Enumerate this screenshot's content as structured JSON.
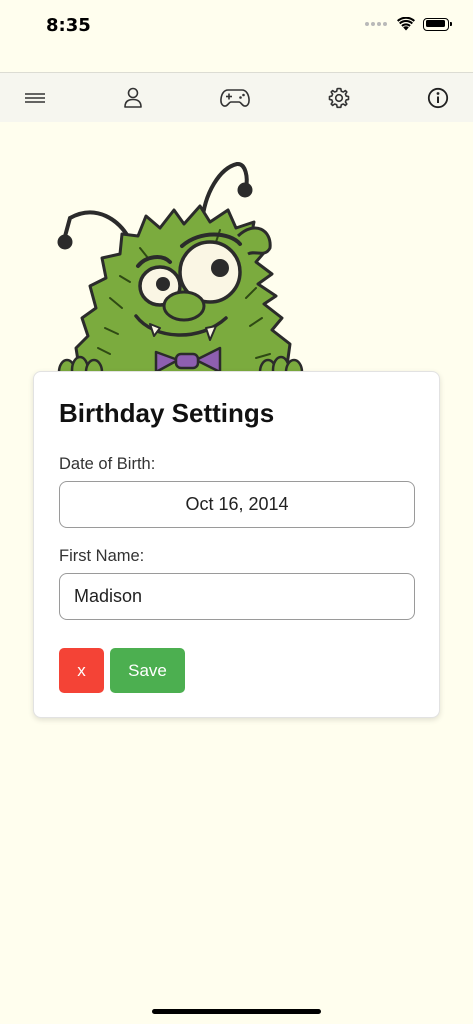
{
  "status_bar": {
    "time": "8:35"
  },
  "toolbar": {
    "items": [
      {
        "name": "menu",
        "icon": "menu-icon"
      },
      {
        "name": "profile",
        "icon": "user-icon"
      },
      {
        "name": "games",
        "icon": "gamepad-icon"
      },
      {
        "name": "settings",
        "icon": "gear-icon"
      },
      {
        "name": "info",
        "icon": "info-icon"
      }
    ]
  },
  "mascot": {
    "icon": "green-monster-mascot",
    "colors": {
      "fur": "#7bab3e",
      "bowtie": "#8e5fb0"
    }
  },
  "form": {
    "title": "Birthday Settings",
    "dob_label": "Date of Birth:",
    "dob_value": "Oct 16, 2014",
    "name_label": "First Name:",
    "name_value": "Madison",
    "cancel_label": "x",
    "save_label": "Save"
  },
  "colors": {
    "background": "#fffeee",
    "cancel": "#f44336",
    "save": "#4caf50"
  }
}
